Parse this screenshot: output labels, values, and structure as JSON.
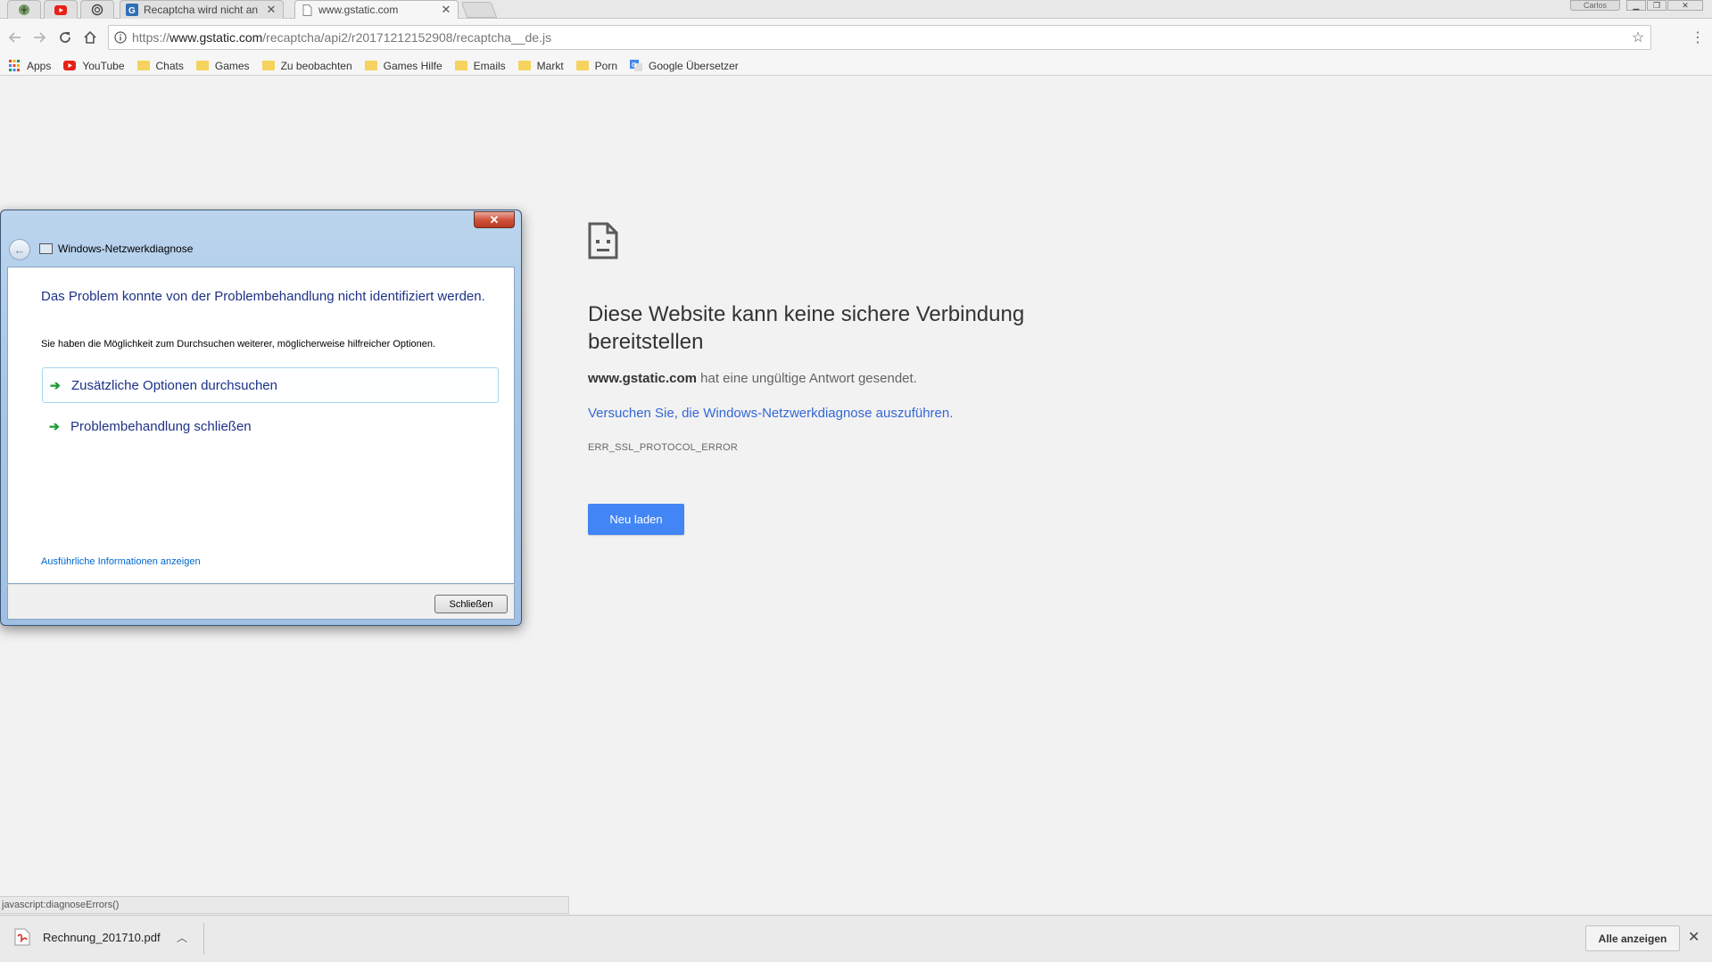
{
  "browser": {
    "tabs": [
      {
        "kind": "pinned",
        "icon": "plant-icon"
      },
      {
        "kind": "pinned",
        "icon": "youtube-icon"
      },
      {
        "kind": "pinned",
        "icon": "spiral-icon"
      },
      {
        "kind": "normal",
        "title": "Recaptcha wird nicht an",
        "icon": "forum-icon"
      },
      {
        "kind": "active",
        "title": "www.gstatic.com",
        "icon": "page-icon"
      }
    ],
    "window_user": "Carlos"
  },
  "omnibox": {
    "scheme": "https://",
    "host": "www.gstatic.com",
    "path": "/recaptcha/api2/r20171212152908/recaptcha__de.js"
  },
  "bookmarks": [
    {
      "label": "Apps",
      "icon": "apps-grid-icon"
    },
    {
      "label": "YouTube",
      "icon": "youtube-icon"
    },
    {
      "label": "Chats",
      "icon": "folder-icon"
    },
    {
      "label": "Games",
      "icon": "folder-icon"
    },
    {
      "label": "Zu beobachten",
      "icon": "folder-icon"
    },
    {
      "label": "Games Hilfe",
      "icon": "folder-icon"
    },
    {
      "label": "Emails",
      "icon": "folder-icon"
    },
    {
      "label": "Markt",
      "icon": "folder-icon"
    },
    {
      "label": "Porn",
      "icon": "folder-icon"
    },
    {
      "label": "Google Übersetzer",
      "icon": "google-translate-icon"
    }
  ],
  "error_page": {
    "title": "Diese Website kann keine sichere Verbindung bereitstellen",
    "host": "www.gstatic.com",
    "description": " hat eine ungültige Antwort gesendet.",
    "link": "Versuchen Sie, die Windows-Netzwerkdiagnose auszuführen.",
    "code": "ERR_SSL_PROTOCOL_ERROR",
    "reload_label": "Neu laden"
  },
  "dialog": {
    "title": "Windows-Netzwerkdiagnose",
    "close_glyph": "✕",
    "heading": "Das Problem konnte von der Problembehandlung nicht identifiziert werden.",
    "subtext": "Sie haben die Möglichkeit zum Durchsuchen weiterer, möglicherweise hilfreicher Optionen.",
    "options": [
      "Zusätzliche Optionen durchsuchen",
      "Problembehandlung schließen"
    ],
    "detail_link": "Ausführliche Informationen anzeigen",
    "close_button": "Schließen"
  },
  "status_bar": "javascript:diagnoseErrors()",
  "download_shelf": {
    "file": "Rechnung_201710.pdf",
    "show_all": "Alle anzeigen"
  },
  "colors": {
    "accent_blue": "#4285f4",
    "link_blue": "#3367d6",
    "dialog_heading": "#1e3287",
    "folder": "#f6d35f"
  }
}
